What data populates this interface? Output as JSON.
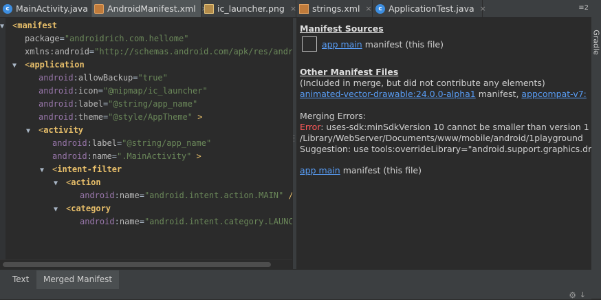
{
  "tabs": [
    {
      "label": "MainActivity.java",
      "icon": "java-class-icon",
      "active": false
    },
    {
      "label": "AndroidManifest.xml",
      "icon": "manifest-file-icon",
      "active": true
    },
    {
      "label": "ic_launcher.png",
      "icon": "image-file-icon",
      "active": false
    },
    {
      "label": "strings.xml",
      "icon": "xml-file-icon",
      "active": false
    },
    {
      "label": "ApplicationTest.java",
      "icon": "java-class-icon",
      "active": false
    }
  ],
  "tab_close_glyph": "×",
  "tab_overflow": "≡2",
  "side_panel": {
    "gradle_label": "Gradle"
  },
  "editor": {
    "fold_glyph": "▼",
    "lines": {
      "l1_tag": "manifest",
      "l2_attr": "package",
      "l2_val": "\"androidrich.com.hellome\"",
      "l3_attr": "xmlns:android",
      "l3_val": "\"http://schemas.android.com/apk/res/andro",
      "l4_tag": "application",
      "l5_ns": "android",
      "l5_attr": "allowBackup",
      "l5_val": "\"true\"",
      "l6_ns": "android",
      "l6_attr": "icon",
      "l6_val": "\"@mipmap/ic_launcher\"",
      "l7_ns": "android",
      "l7_attr": "label",
      "l7_val": "\"@string/app_name\"",
      "l8_ns": "android",
      "l8_attr": "theme",
      "l8_val": "\"@style/AppTheme\"",
      "l8_end": " >",
      "l9_tag": "activity",
      "l10_ns": "android",
      "l10_attr": "label",
      "l10_val": "\"@string/app_name\"",
      "l11_ns": "android",
      "l11_attr": "name",
      "l11_val": "\".MainActivity\"",
      "l11_end": " >",
      "l12_tag": "intent-filter",
      "l13_tag": "action",
      "l14_ns": "android",
      "l14_attr": "name",
      "l14_val": "\"android.intent.action.MAIN\"",
      "l14_end": " />",
      "l15_tag": "category",
      "l16_ns": "android",
      "l16_attr": "name",
      "l16_val": "\"android.intent.category.LAUNCH"
    }
  },
  "merged_panel": {
    "sources_header": "Manifest Sources",
    "source_link": "app main",
    "source_suffix": " manifest (this file)",
    "other_header": "Other Manifest Files",
    "other_note": "(Included in merge, but did not contribute any elements)",
    "other_link1": "animated-vector-drawable:24.0.0-alpha1",
    "other_mid": " manifest, ",
    "other_link2": "appcompat-v7:",
    "errors_label": "Merging Errors:",
    "error_keyword": "Error",
    "error_text": ": uses-sdk:minSdkVersion 10 cannot be smaller than version 1",
    "error_path": "/Library/WebServer/Documents/www/mobile/android/1playground",
    "suggestion": "Suggestion: use tools:overrideLibrary=\"android.support.graphics.dr",
    "footer_link": "app main",
    "footer_suffix": " manifest (this file)"
  },
  "bottom_tabs": [
    {
      "label": "Text",
      "active": false
    },
    {
      "label": "Merged Manifest",
      "active": true
    }
  ],
  "colors": {
    "tag": "#e8bf6a",
    "value": "#6a8759",
    "namespace": "#9876aa",
    "link": "#589df6",
    "error": "#ff5a5a"
  }
}
